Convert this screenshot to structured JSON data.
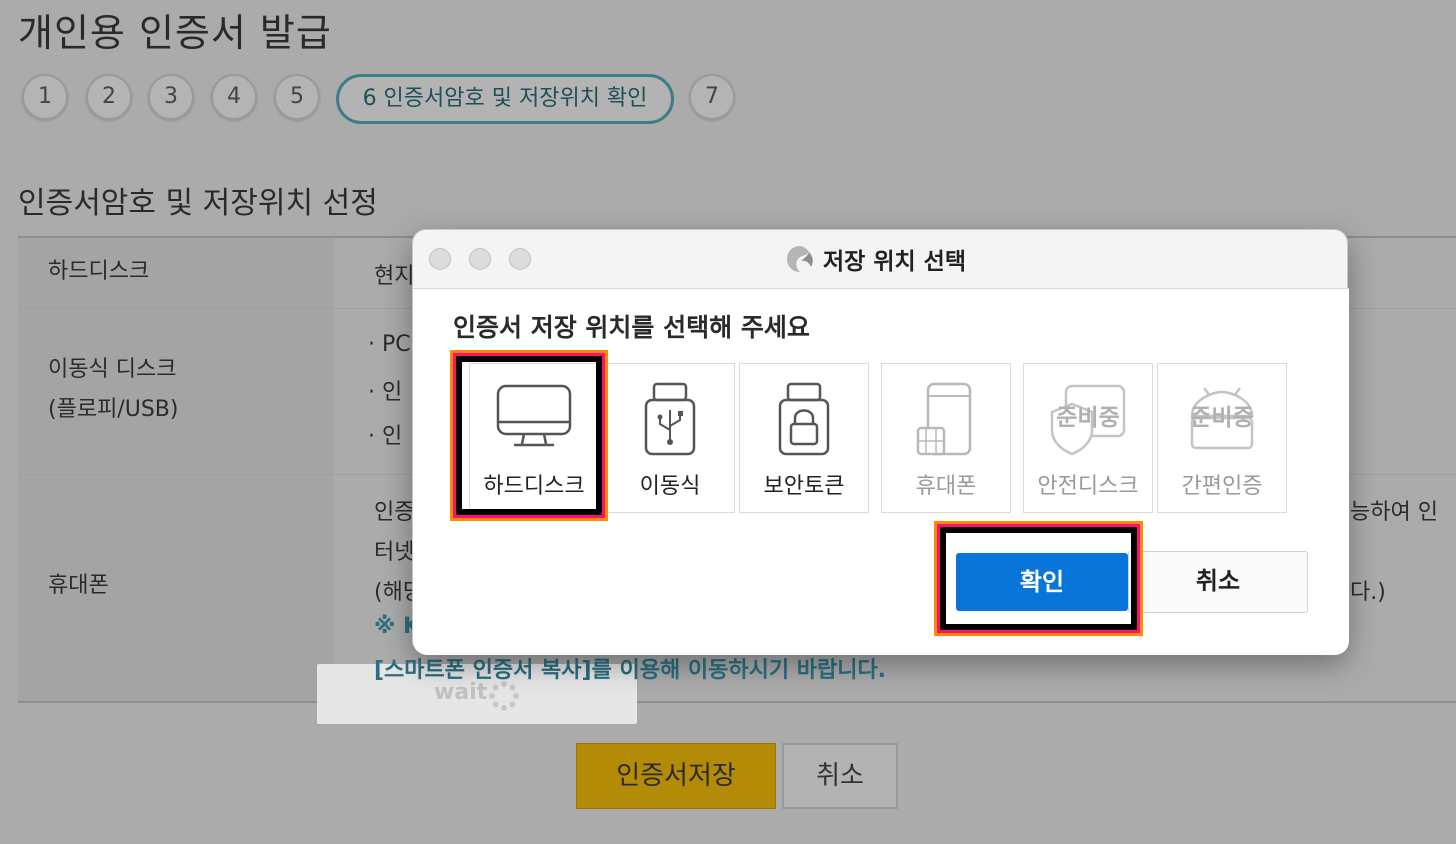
{
  "page": {
    "title": "개인용 인증서 발급",
    "steps": [
      "1",
      "2",
      "3",
      "4",
      "5",
      "6 인증서암호 및 저장위치 확인",
      "7"
    ],
    "section_title": "인증서암호 및 저장위치 선정",
    "rows": [
      {
        "label": "하드디스크",
        "text": [
          "현지"
        ]
      },
      {
        "label": "이동식 디스크",
        "label2": "(플로피/USB)",
        "text": [
          "· PC",
          "· 인",
          "· 인"
        ]
      },
      {
        "label": "휴대폰",
        "text": [
          "인증",
          "터넷",
          "(해당",
          "※ K",
          "[스마트폰 인증서 복사]를 이용해 이동하시기 바랍니다."
        ],
        "right_text": [
          "능하여 인",
          "다.)"
        ]
      }
    ],
    "wait_text": "wait",
    "save_button": "인증서저장",
    "cancel_button": "취소"
  },
  "dialog": {
    "title": "저장 위치 선택",
    "prompt": "인증서 저장 위치를 선택해 주세요",
    "options": [
      {
        "label": "하드디스크",
        "icon": "monitor-icon",
        "enabled": true,
        "selected": true
      },
      {
        "label": "이동식",
        "icon": "usb-drive-icon",
        "enabled": true
      },
      {
        "label": "보안토큰",
        "icon": "lock-token-icon",
        "enabled": true
      },
      {
        "label": "휴대폰",
        "icon": "phone-icon",
        "enabled": false
      },
      {
        "label": "안전디스크",
        "icon": "shield-disk-icon",
        "enabled": false,
        "badge": "준비중"
      },
      {
        "label": "간편인증",
        "icon": "android-icon",
        "enabled": false,
        "badge": "준비중"
      }
    ],
    "ok_button": "확인",
    "cancel_button": "취소"
  },
  "colors": {
    "overlay_bg": "#ababab",
    "primary_button": "#0a75d8",
    "save_button": "#b48b06",
    "highlight_pink": "#ff0f73",
    "highlight_orange": "#ff8c00",
    "step_current_border": "#3f7c86"
  }
}
